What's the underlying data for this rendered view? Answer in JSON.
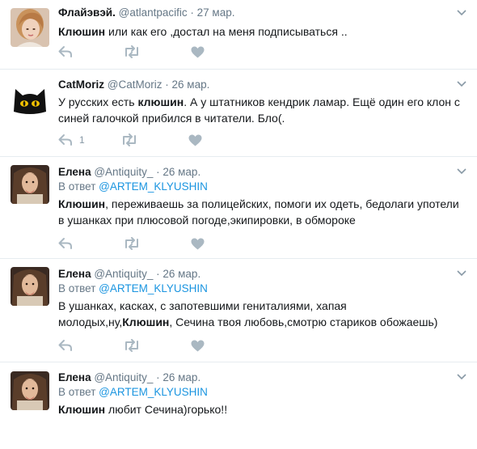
{
  "tweets": [
    {
      "fullname": "Флайэвэй.",
      "username": "@atlantpacific",
      "separator": "·",
      "time": "27 мар.",
      "reply_prefix": "",
      "reply_to": "",
      "text_parts": [
        {
          "b": "Клюшин"
        },
        {
          "t": " или как его ,достал на меня подписываться .."
        }
      ],
      "reply_count": ""
    },
    {
      "fullname": "CatMoriz",
      "username": "@CatMoriz",
      "separator": "·",
      "time": "26 мар.",
      "reply_prefix": "",
      "reply_to": "",
      "text_parts": [
        {
          "t": "У русских есть "
        },
        {
          "b": "клюшин"
        },
        {
          "t": ". А у штатников кендрик ламар. Ещё один его клон с синей галочкой прибился в читатели. Бло(."
        }
      ],
      "reply_count": "1"
    },
    {
      "fullname": "Елена",
      "username": "@Antiquity_",
      "separator": "·",
      "time": "26 мар.",
      "reply_prefix": "В ответ ",
      "reply_to": "@ARTEM_KLYUSHIN",
      "text_parts": [
        {
          "b": "Клюшин"
        },
        {
          "t": ", переживаешь за полицейских, помоги их одеть, бедолаги употели в ушанках при плюсовой погоде,экипировки, в обмороке"
        }
      ],
      "reply_count": ""
    },
    {
      "fullname": "Елена",
      "username": "@Antiquity_",
      "separator": "·",
      "time": "26 мар.",
      "reply_prefix": "В ответ ",
      "reply_to": "@ARTEM_KLYUSHIN",
      "text_parts": [
        {
          "t": "В ушанках, касках, с запотевшими гениталиями, хапая молодых,ну,"
        },
        {
          "b": "Клюшин"
        },
        {
          "t": ", Сечина твоя любовь,смотрю стариков обожаешь)"
        }
      ],
      "reply_count": ""
    },
    {
      "fullname": "Елена",
      "username": "@Antiquity_",
      "separator": "·",
      "time": "26 мар.",
      "reply_prefix": "В ответ ",
      "reply_to": "@ARTEM_KLYUSHIN",
      "text_parts": [
        {
          "b": "Клюшин"
        },
        {
          "t": " любит Сечина)горько!!"
        }
      ],
      "reply_count": ""
    }
  ]
}
